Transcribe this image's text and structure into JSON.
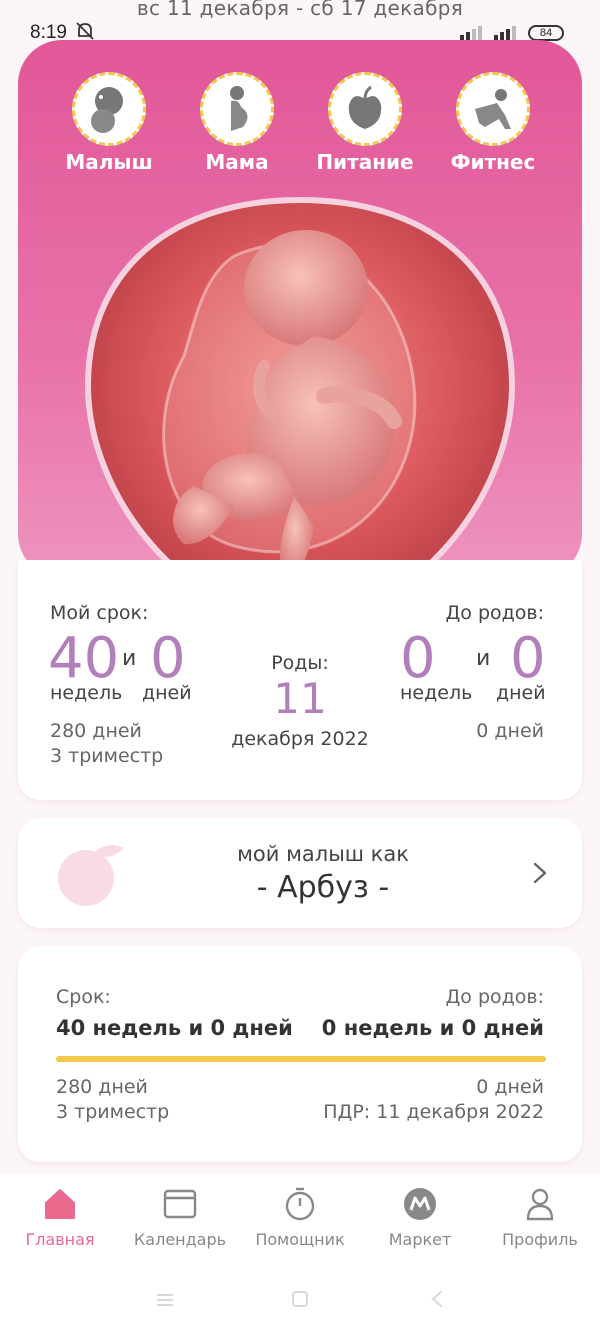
{
  "status_bar": {
    "time": "8:19",
    "battery": "84"
  },
  "header": {
    "date_range": "вс 11 декабря - сб 17 декабря"
  },
  "hero_nav": [
    {
      "label": "Малыш",
      "icon": "baby-icon"
    },
    {
      "label": "Мама",
      "icon": "pregnant-woman-icon"
    },
    {
      "label": "Питание",
      "icon": "apple-icon"
    },
    {
      "label": "Фитнес",
      "icon": "yoga-icon"
    }
  ],
  "term": {
    "title": "Мой срок:",
    "weeks": "40",
    "and": "и",
    "days": "0",
    "weeks_label": "недель",
    "days_label": "дней",
    "total_days": "280 дней",
    "trimester": "3 триместр"
  },
  "birth": {
    "title": "Роды:",
    "day": "11",
    "month_year": "декабря 2022"
  },
  "until_birth": {
    "title": "До родов:",
    "weeks": "0",
    "and": "и",
    "days": "0",
    "weeks_label": "недель",
    "days_label": "дней",
    "total_days": "0 дней"
  },
  "fruit_card": {
    "line1": "мой малыш как",
    "fruit": "- Арбуз -"
  },
  "summary": {
    "term_title": "Срок:",
    "term_value": "40 недель и 0 дней",
    "until_title": "До родов:",
    "until_value": "0 недель и 0 дней",
    "progress": 1.0,
    "total_days": "280 дней",
    "trimester": "3 триместр",
    "remaining_days": "0 дней",
    "due_date": "ПДР: 11 декабря 2022"
  },
  "bottom_nav": [
    {
      "label": "Главная",
      "icon": "home-icon",
      "active": true
    },
    {
      "label": "Календарь",
      "icon": "calendar-icon",
      "active": false
    },
    {
      "label": "Помощник",
      "icon": "timer-icon",
      "active": false
    },
    {
      "label": "Маркет",
      "icon": "market-icon",
      "active": false
    },
    {
      "label": "Профиль",
      "icon": "profile-icon",
      "active": false
    }
  ],
  "colors": {
    "brand_pink": "#e25798",
    "accent_purple": "#b27fbd",
    "progress_yellow": "#f4c84b",
    "active_tab": "#ea6a8e"
  }
}
